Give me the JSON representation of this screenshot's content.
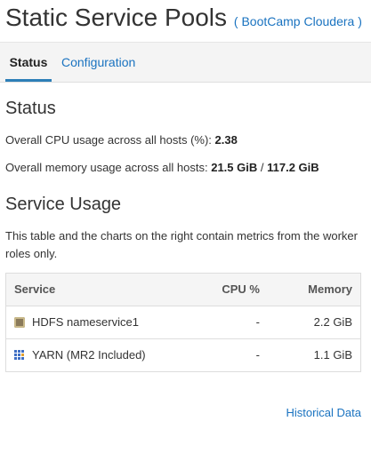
{
  "header": {
    "title": "Static Service Pools",
    "cluster_open": "(",
    "cluster_name": "BootCamp Cloudera",
    "cluster_close": ")"
  },
  "tabs": [
    {
      "label": "Status",
      "active": true
    },
    {
      "label": "Configuration",
      "active": false
    }
  ],
  "status": {
    "title": "Status",
    "cpu_label": "Overall CPU usage across all hosts (%):",
    "cpu_value": "2.38",
    "memory_label": "Overall memory usage across all hosts:",
    "memory_used": "21.5 GiB",
    "memory_sep": "/",
    "memory_total": "117.2 GiB"
  },
  "service_usage": {
    "title": "Service Usage",
    "description": "This table and the charts on the right contain metrics from the worker roles only.",
    "columns": [
      "Service",
      "CPU %",
      "Memory"
    ],
    "rows": [
      {
        "icon": "hdfs-icon",
        "service": "HDFS nameservice1",
        "cpu": "-",
        "memory": "2.2 GiB"
      },
      {
        "icon": "yarn-icon",
        "service": "YARN (MR2 Included)",
        "cpu": "-",
        "memory": "1.1 GiB"
      }
    ]
  },
  "footer": {
    "historical_link": "Historical Data"
  },
  "colors": {
    "link": "#1a73c0",
    "active_tab_underline": "#2d7fb8"
  }
}
